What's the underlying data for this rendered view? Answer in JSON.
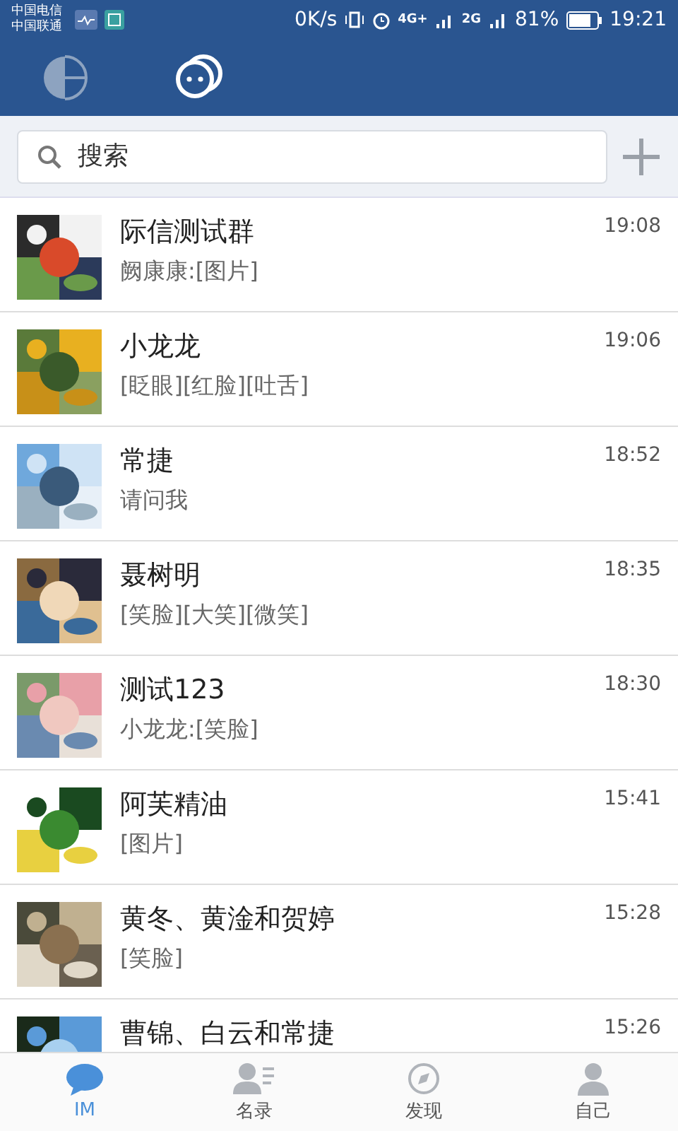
{
  "status_bar": {
    "carriers": [
      "中国电信",
      "中国联通"
    ],
    "speed": "0K/s",
    "network_labels": [
      "4G+",
      "2G"
    ],
    "battery_percent": "81%",
    "time": "19:21"
  },
  "header_tabs": [
    {
      "kind": "logo",
      "selected": false
    },
    {
      "kind": "chat",
      "selected": true
    }
  ],
  "search": {
    "placeholder": "搜索"
  },
  "conversations": [
    {
      "name": "际信测试群",
      "message": "阙康康:[图片]",
      "time": "19:08"
    },
    {
      "name": "小龙龙",
      "message": "[眨眼][红脸][吐舌]",
      "time": "19:06"
    },
    {
      "name": "常捷",
      "message": "请问我",
      "time": "18:52"
    },
    {
      "name": "聂树明",
      "message": "[笑脸][大笑][微笑]",
      "time": "18:35"
    },
    {
      "name": "测试123",
      "message": "小龙龙:[笑脸]",
      "time": "18:30"
    },
    {
      "name": "阿芙精油",
      "message": "[图片]",
      "time": "15:41"
    },
    {
      "name": "黄冬、黄淦和贺婷",
      "message": "[笑脸]",
      "time": "15:28"
    },
    {
      "name": "曹锦、白云和常捷",
      "time": "15:26"
    }
  ],
  "bottom_tabs": [
    {
      "kind": "chat",
      "label": "IM",
      "selected": true
    },
    {
      "kind": "contacts",
      "label": "名录",
      "selected": false
    },
    {
      "kind": "discover",
      "label": "发现",
      "selected": false
    },
    {
      "kind": "me",
      "label": "自己",
      "selected": false
    }
  ]
}
